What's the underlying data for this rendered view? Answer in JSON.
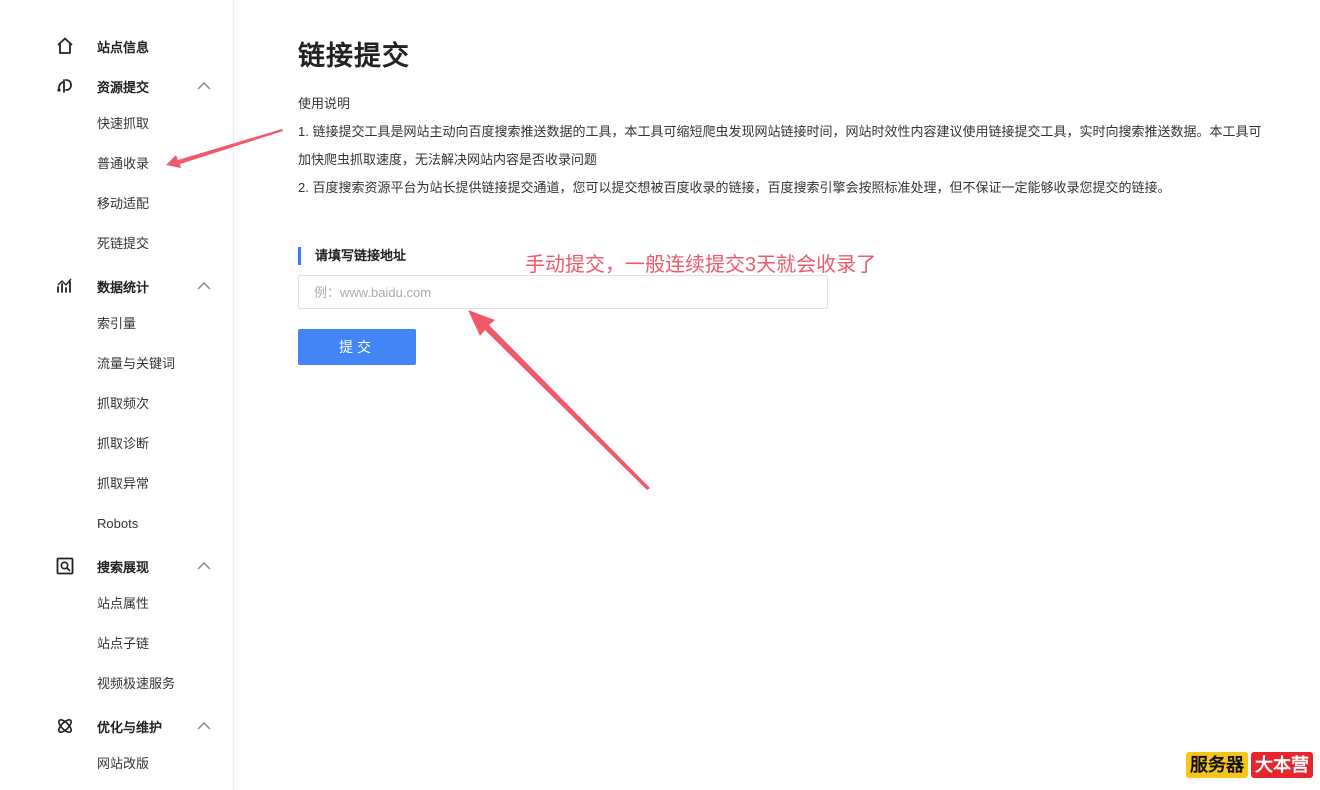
{
  "sidebar": {
    "site_info": {
      "label": "站点信息",
      "icon": "home-icon"
    },
    "resource_submit": {
      "label": "资源提交",
      "icon": "link-upload-icon",
      "items": [
        "快速抓取",
        "普通收录",
        "移动适配",
        "死链提交"
      ]
    },
    "data_stats": {
      "label": "数据统计",
      "icon": "stats-chart-icon",
      "items": [
        "索引量",
        "流量与关键词",
        "抓取频次",
        "抓取诊断",
        "抓取异常",
        "Robots"
      ]
    },
    "search_display": {
      "label": "搜索展现",
      "icon": "search-display-icon",
      "items": [
        "站点属性",
        "站点子链",
        "视频极速服务"
      ]
    },
    "optimize": {
      "label": "优化与维护",
      "icon": "atom-icon",
      "items": [
        "网站改版"
      ]
    }
  },
  "main": {
    "title": "链接提交",
    "usage_heading": "使用说明",
    "usage_lines": [
      "1. 链接提交工具是网站主动向百度搜索推送数据的工具，本工具可缩短爬虫发现网站链接时间，网站时效性内容建议使用链接提交工具，实时向搜索推送数据。本工具可加快爬虫抓取速度，无法解决网站内容是否收录问题",
      "2. 百度搜索资源平台为站长提供链接提交通道，您可以提交想被百度收录的链接，百度搜索引擎会按照标准处理，但不保证一定能够收录您提交的链接。"
    ],
    "section_label": "请填写链接地址",
    "input_value": "",
    "input_placeholder": "例：www.baidu.com",
    "submit_label": "提交"
  },
  "annotation": {
    "text": "手动提交，一般连续提交3天就会收录了",
    "color": "#f0596a"
  },
  "watermark": {
    "part1": "服务器",
    "part2": "大本营"
  },
  "colors": {
    "accent": "#4285f4",
    "annotation": "#f0596a",
    "section_bar": "#3b7cf5"
  }
}
